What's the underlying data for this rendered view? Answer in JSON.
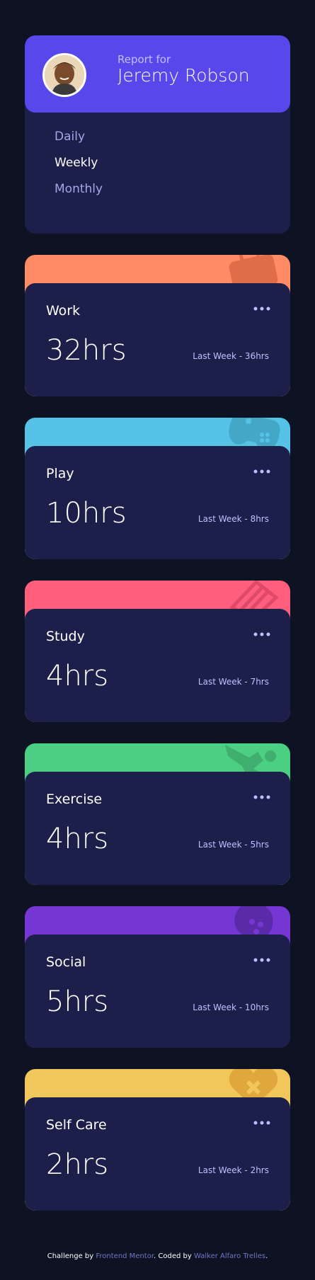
{
  "profile": {
    "report_for": "Report for",
    "name": "Jeremy Robson",
    "header_color": "#5847eb"
  },
  "periods": [
    {
      "label": "Daily",
      "active": false
    },
    {
      "label": "Weekly",
      "active": true
    },
    {
      "label": "Monthly",
      "active": false
    }
  ],
  "activities": [
    {
      "title": "Work",
      "hours": "32hrs",
      "last_week": "Last Week - 36hrs",
      "color": "#ff8b64",
      "icon": "briefcase-icon"
    },
    {
      "title": "Play",
      "hours": "10hrs",
      "last_week": "Last Week - 8hrs",
      "color": "#55c2e6",
      "icon": "gamepad-icon"
    },
    {
      "title": "Study",
      "hours": "4hrs",
      "last_week": "Last Week - 7hrs",
      "color": "#ff5e7d",
      "icon": "books-icon"
    },
    {
      "title": "Exercise",
      "hours": "4hrs",
      "last_week": "Last Week - 5hrs",
      "color": "#4bcf82",
      "icon": "runner-icon"
    },
    {
      "title": "Social",
      "hours": "5hrs",
      "last_week": "Last Week - 10hrs",
      "color": "#7536d3",
      "icon": "chat-icon"
    },
    {
      "title": "Self Care",
      "hours": "2hrs",
      "last_week": "Last Week - 2hrs",
      "color": "#f1c65b",
      "icon": "heart-icon"
    }
  ],
  "footer": {
    "challenge_by": "Challenge by",
    "frontend_mentor": "Frontend Mentor",
    "coded_by": ". Coded by",
    "author": "Walker Alfaro Trelles",
    "end": "."
  }
}
